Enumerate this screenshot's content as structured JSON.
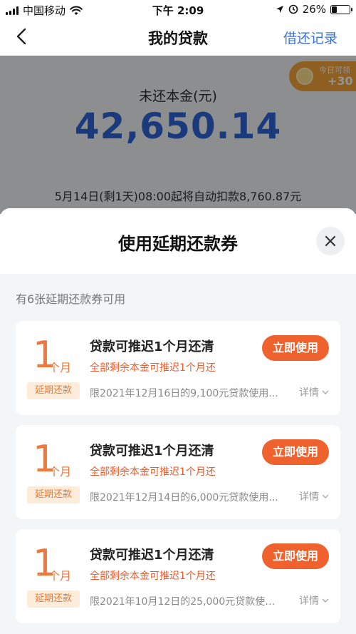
{
  "status_bar": {
    "carrier": "中国移动",
    "time": "下午 2:09",
    "battery": "26%"
  },
  "nav": {
    "title": "我的贷款",
    "action": "借还记录"
  },
  "header": {
    "principal_label": "未还本金(元)",
    "principal_amount": "42,650.14",
    "deduct_note": "5月14日(剩1天)08:00起将自动扣款8,760.87元",
    "reward_label": "今日可领",
    "reward_value": "+30"
  },
  "sheet": {
    "title": "使用延期还款券",
    "coupon_count": "有6张延期还款券可用"
  },
  "coupons": [
    {
      "number": "1",
      "unit": "个月",
      "tag": "延期还款",
      "title": "贷款可推迟1个月还清",
      "subtitle": "全部剩余本金可推迟1个月还",
      "condition": "限2021年12月16日的9,100元贷款使用...",
      "button": "立即使用",
      "detail": "详情"
    },
    {
      "number": "1",
      "unit": "个月",
      "tag": "延期还款",
      "title": "贷款可推迟1个月还清",
      "subtitle": "全部剩余本金可推迟1个月还",
      "condition": "限2021年12月14日的6,000元贷款使用...",
      "button": "立即使用",
      "detail": "详情"
    },
    {
      "number": "1",
      "unit": "个月",
      "tag": "延期还款",
      "title": "贷款可推迟1个月还清",
      "subtitle": "全部剩余本金可推迟1个月还",
      "condition": "限2021年10月12日的25,000元贷款使用...",
      "button": "立即使用",
      "detail": "详情"
    }
  ],
  "colors": {
    "accent_blue": "#2d64d8",
    "accent_orange": "#f0622d",
    "overlay": "rgba(0,0,0,0.42)"
  }
}
